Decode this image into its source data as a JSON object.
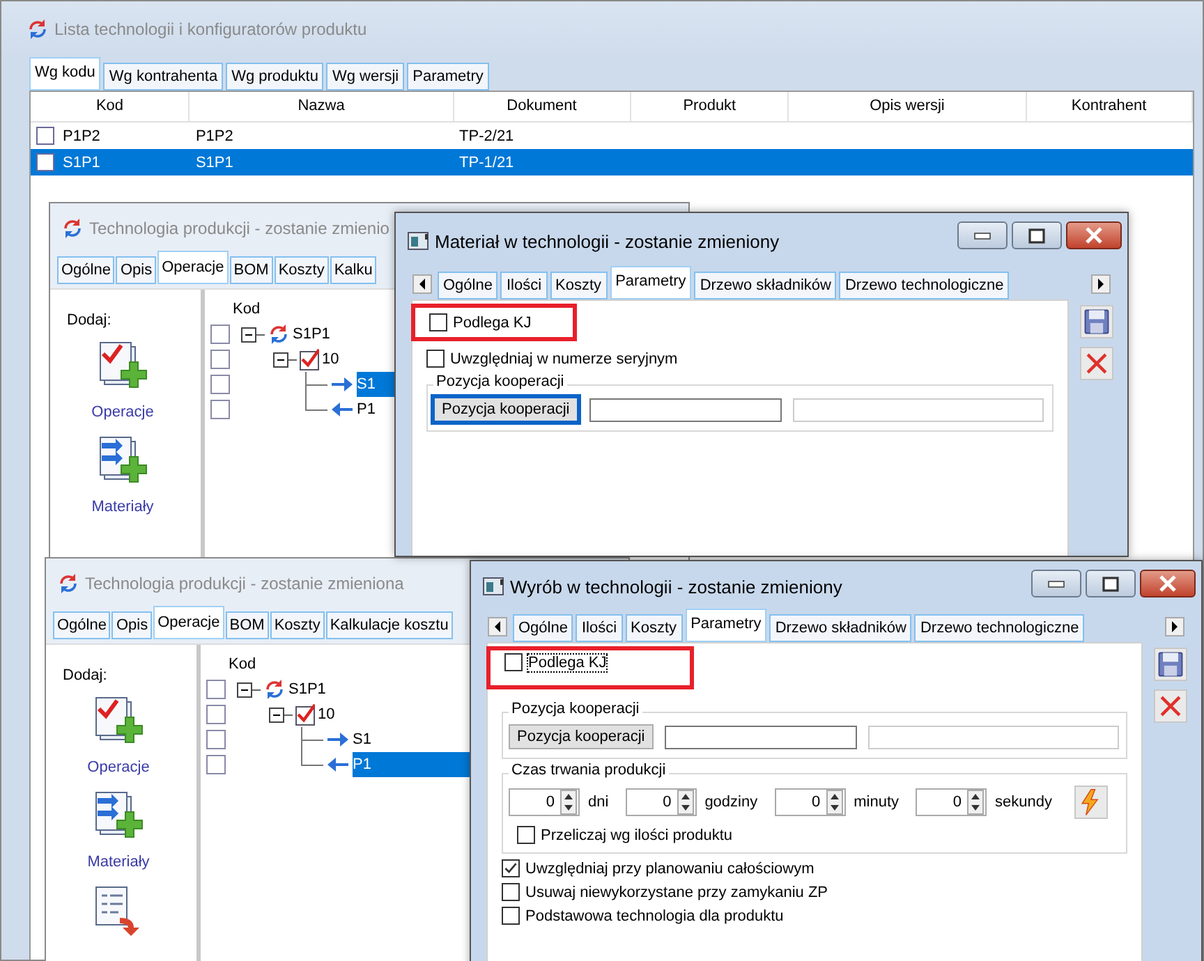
{
  "main_window": {
    "title": "Lista technologii i konfiguratorów produktu",
    "tabs": [
      {
        "label": "Wg kodu",
        "selected": true
      },
      {
        "label": "Wg kontrahenta",
        "selected": false
      },
      {
        "label": "Wg produktu",
        "selected": false
      },
      {
        "label": "Wg wersji",
        "selected": false
      },
      {
        "label": "Parametry",
        "selected": false
      }
    ],
    "table": {
      "columns": [
        "Kod",
        "Nazwa",
        "Dokument",
        "Produkt",
        "Opis wersji",
        "Kontrahent"
      ],
      "rows": [
        {
          "checked": false,
          "selected": false,
          "cells": [
            "P1P2",
            "P1P2",
            "TP-2/21"
          ]
        },
        {
          "checked": false,
          "selected": true,
          "cells": [
            "S1P1",
            "S1P1",
            "TP-1/21"
          ]
        }
      ]
    }
  },
  "technology_windows": [
    {
      "title": "Technologia produkcji - zostanie zmienio",
      "tabs": [
        {
          "label": "Ogólne",
          "selected": false
        },
        {
          "label": "Opis",
          "selected": false
        },
        {
          "label": "Operacje",
          "selected": true
        },
        {
          "label": "BOM",
          "selected": false
        },
        {
          "label": "Koszty",
          "selected": false
        },
        {
          "label": "Kalku",
          "selected": false
        }
      ],
      "add_label": "Dodaj:",
      "add_actions": [
        {
          "kind": "operation",
          "label": "Operacje"
        },
        {
          "kind": "material",
          "label": "Materiały"
        }
      ],
      "tree": {
        "header": "Kod",
        "nodes": [
          {
            "kind": "technology",
            "label": "S1P1",
            "checked": false,
            "expanded": true,
            "selected": false,
            "children": [
              {
                "kind": "operation",
                "label": "10",
                "checked": false,
                "expanded": true,
                "selected": false,
                "children": [
                  {
                    "kind": "input",
                    "label": "S1",
                    "checked": false,
                    "selected": true
                  },
                  {
                    "kind": "output",
                    "label": "P1",
                    "checked": false,
                    "selected": false
                  }
                ]
              }
            ]
          }
        ]
      }
    },
    {
      "title": "Technologia produkcji - zostanie zmieniona",
      "tabs": [
        {
          "label": "Ogólne",
          "selected": false
        },
        {
          "label": "Opis",
          "selected": false
        },
        {
          "label": "Operacje",
          "selected": true
        },
        {
          "label": "BOM",
          "selected": false
        },
        {
          "label": "Koszty",
          "selected": false
        },
        {
          "label": "Kalkulacje kosztu",
          "selected": false
        }
      ],
      "add_label": "Dodaj:",
      "add_actions": [
        {
          "kind": "operation",
          "label": "Operacje"
        },
        {
          "kind": "material",
          "label": "Materiały"
        },
        {
          "kind": "route"
        }
      ],
      "tree": {
        "header": "Kod",
        "nodes": [
          {
            "kind": "technology",
            "label": "S1P1",
            "checked": false,
            "expanded": true,
            "selected": false,
            "children": [
              {
                "kind": "operation",
                "label": "10",
                "checked": false,
                "expanded": true,
                "selected": false,
                "children": [
                  {
                    "kind": "input",
                    "label": "S1",
                    "checked": false,
                    "selected": false
                  },
                  {
                    "kind": "output",
                    "label": "P1",
                    "checked": false,
                    "selected": true
                  }
                ]
              }
            ]
          }
        ]
      }
    }
  ],
  "dialogs": [
    {
      "title": "Materiał w technologii - zostanie zmieniony",
      "tabs": [
        {
          "label": "Ogólne",
          "selected": false
        },
        {
          "label": "Ilości",
          "selected": false
        },
        {
          "label": "Koszty",
          "selected": false
        },
        {
          "label": "Parametry",
          "selected": true
        },
        {
          "label": "Drzewo składników",
          "selected": false
        },
        {
          "label": "Drzewo technologiczne",
          "selected": false
        }
      ],
      "items": [
        {
          "kind": "checkbox",
          "label": "Podlega KJ",
          "checked": false,
          "highlighted": true,
          "focused": false
        },
        {
          "kind": "checkbox",
          "label": "Uwzględniaj w numerze seryjnym",
          "checked": false,
          "highlighted": false,
          "focused": false
        },
        {
          "kind": "cooperation",
          "title": "Pozycja kooperacji",
          "button": "Pozycja kooperacji",
          "focused": true
        }
      ]
    },
    {
      "title": "Wyrób w technologii - zostanie zmieniony",
      "tabs": [
        {
          "label": "Ogólne",
          "selected": false
        },
        {
          "label": "Ilości",
          "selected": false
        },
        {
          "label": "Koszty",
          "selected": false
        },
        {
          "label": "Parametry",
          "selected": true
        },
        {
          "label": "Drzewo składników",
          "selected": false
        },
        {
          "label": "Drzewo technologiczne",
          "selected": false
        }
      ],
      "items": [
        {
          "kind": "checkbox",
          "label": "Podlega KJ",
          "checked": false,
          "highlighted": true,
          "focused": true
        },
        {
          "kind": "cooperation",
          "title": "Pozycja kooperacji",
          "button": "Pozycja kooperacji",
          "focused": false
        },
        {
          "kind": "duration",
          "title": "Czas trwania produkcji",
          "spinners": [
            {
              "value": "0",
              "unit": "dni"
            },
            {
              "value": "0",
              "unit": "godziny"
            },
            {
              "value": "0",
              "unit": "minuty"
            },
            {
              "value": "0",
              "unit": "sekundy"
            }
          ],
          "checkbox": {
            "label": "Przeliczaj wg ilości produktu",
            "checked": false
          }
        },
        {
          "kind": "checkbox",
          "label": "Uwzględniaj przy planowaniu całościowym",
          "checked": true,
          "highlighted": false,
          "focused": false
        },
        {
          "kind": "checkbox",
          "label": "Usuwaj niewykorzystane przy zamykaniu ZP",
          "checked": false,
          "highlighted": false,
          "focused": false
        },
        {
          "kind": "checkbox",
          "label": "Podstawowa technologia dla produktu",
          "checked": false,
          "highlighted": false,
          "focused": false
        }
      ]
    }
  ]
}
